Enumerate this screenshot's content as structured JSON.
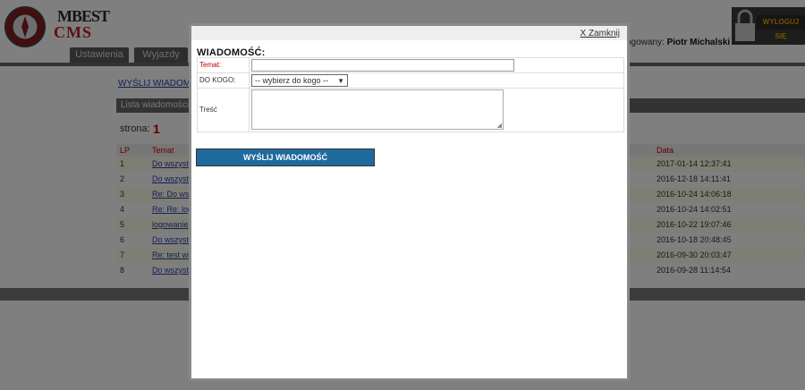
{
  "background": {
    "logo": {
      "line1": "MBEST",
      "line2": "CMS"
    },
    "nav_tabs": [
      "Ustawienia",
      "Wyjazdy"
    ],
    "user": {
      "prefix": "ogowany:",
      "name": "Piotr Michalski"
    },
    "logout_label": "WYLOGUJ SIĘ",
    "send_link": "WYŚLIJ WIADOMOŚ",
    "list_header": "Lista wiadomości",
    "page_label": "strona:",
    "page_number": "1",
    "columns": {
      "lp": "LP",
      "subject": "Temat",
      "date": "Data"
    },
    "rows": [
      {
        "lp": "1",
        "subject": "Do wszystk",
        "date": "2017-01-14 12:37:41"
      },
      {
        "lp": "2",
        "subject": "Do wszystk",
        "date": "2016-12-18 14:11:41"
      },
      {
        "lp": "3",
        "subject": "Re: Do wsz",
        "date": "2016-10-24 14:06:18"
      },
      {
        "lp": "4",
        "subject": "Re: Re: log",
        "date": "2016-10-24 14:02:51"
      },
      {
        "lp": "5",
        "subject": "logowanie",
        "date": "2016-10-22 19:07:46"
      },
      {
        "lp": "6",
        "subject": "Do wszystk",
        "date": "2016-10-18 20:48:45"
      },
      {
        "lp": "7",
        "subject": "Re: test wi",
        "date": "2016-09-30 20:03:47"
      },
      {
        "lp": "8",
        "subject": "Do wszystk",
        "date": "2016-09-28 11:14:54"
      }
    ]
  },
  "modal": {
    "close_label": "X Zamknij",
    "title": "WIADOMOŚĆ:",
    "fields": {
      "subject_label": "Temat:",
      "subject_value": "",
      "to_label": "DO KOGO:",
      "to_selected": "-- wybierz do kogo --",
      "body_label": "Treść",
      "body_value": ""
    },
    "submit_label": "WYŚLIJ WIADOMOŚĆ"
  },
  "colors": {
    "accent": "#1f6a9d",
    "label_red": "#c00000"
  }
}
